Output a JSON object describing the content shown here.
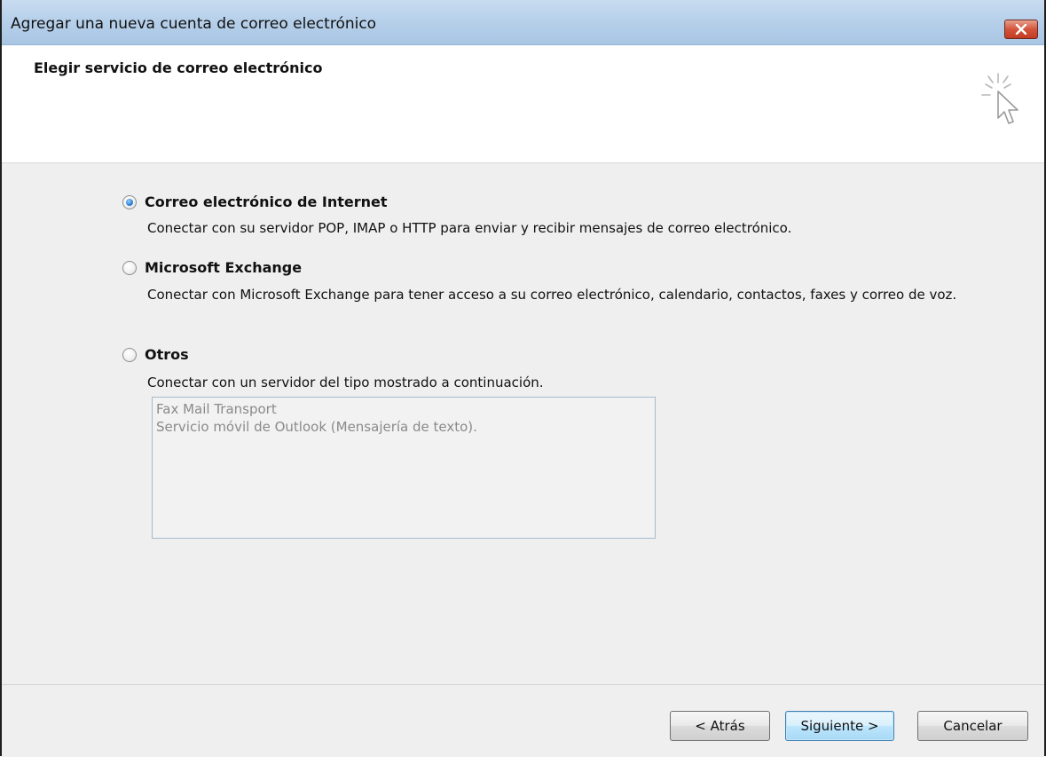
{
  "window": {
    "title": "Agregar una nueva cuenta de correo electrónico",
    "close_icon": "close-x-icon"
  },
  "header": {
    "title": "Elegir servicio de correo electrónico",
    "icon": "sparkle-cursor-icon"
  },
  "options": [
    {
      "label": "Correo electrónico de Internet",
      "description": "Conectar con su servidor POP, IMAP o HTTP para enviar y recibir mensajes de correo electrónico.",
      "selected": true
    },
    {
      "label": "Microsoft Exchange",
      "description": "Conectar con Microsoft Exchange para tener acceso a su correo electrónico, calendario, contactos, faxes y correo de voz.",
      "selected": false
    },
    {
      "label": "Otros",
      "description": "Conectar con un servidor del tipo mostrado a continuación.",
      "selected": false
    }
  ],
  "other_services": [
    "Fax Mail Transport",
    "Servicio móvil de Outlook (Mensajería de texto)."
  ],
  "buttons": {
    "back": "< Atrás",
    "next": "Siguiente >",
    "cancel": "Cancelar"
  },
  "colors": {
    "titlebar": "#b7d0ea",
    "close_button": "#c23b22",
    "radio_selected": "#2d7ed2",
    "default_button_border": "#3c7fb1"
  }
}
